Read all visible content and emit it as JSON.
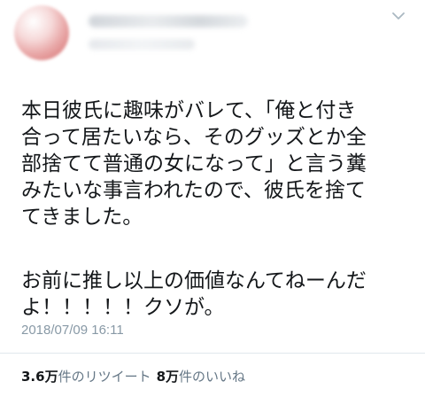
{
  "tweet": {
    "paragraph_1": "本日彼氏に趣味がバレて、「俺と付き\n合って居たいなら、そのグッズとか全\n部捨てて普通の女になって」と言う糞\nみたいな事言われたので、彼氏を捨て\nてきました。",
    "paragraph_2": "お前に推し以上の価値なんてねーんだ\nよ！！！！！クソが。",
    "timestamp": "2018/07/09 16:11"
  },
  "stats": {
    "retweets_count": "3.6万",
    "retweets_label": "件のリツイート",
    "likes_count": "8万",
    "likes_label": "件のいいね"
  },
  "icons": {
    "menu": "chevron-down-icon"
  },
  "colors": {
    "text": "#14171a",
    "secondary": "#8899a6",
    "divider": "#e1e8ed"
  }
}
